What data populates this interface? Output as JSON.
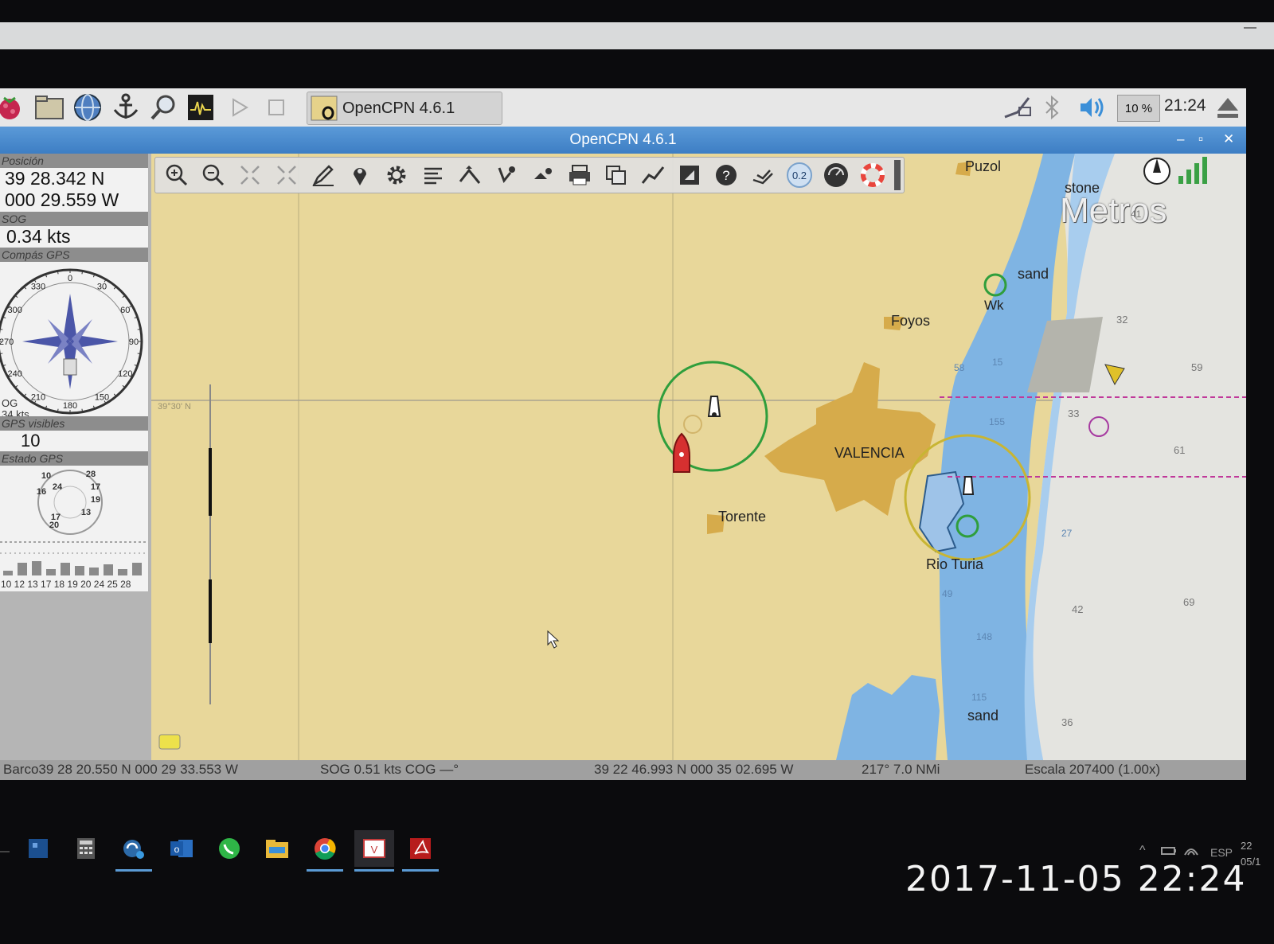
{
  "taskbar": {
    "app_title": "OpenCPN 4.6.1",
    "cpu_label": "10 %",
    "clock": "21:24",
    "launchers": [
      "raspberry-icon",
      "file-manager-icon",
      "web-browser-icon",
      "anchor-icon",
      "search-icon",
      "terminal-icon",
      "play-icon",
      "stop-icon"
    ]
  },
  "window": {
    "title": "OpenCPN 4.6.1",
    "minimize": "–",
    "maximize": "▫",
    "close": "✕"
  },
  "dashboard": {
    "position_title": "Posición",
    "lat": "39 28.342 N",
    "lon": "000 29.559 W",
    "sog_title": "SOG",
    "sog": "0.34 kts",
    "compass_title": "Compás GPS",
    "compass_ticks": [
      "0",
      "30",
      "60",
      "90",
      "120",
      "150",
      "180",
      "210",
      "240",
      "270",
      "300",
      "330"
    ],
    "compass_readout": [
      "OG",
      "34 kts"
    ],
    "gps_visible_title": "GPS visibles",
    "gps_visible": "10",
    "gps_status_title": "Estado GPS",
    "sat_ids": [
      "10",
      "28",
      "16",
      "24",
      "17",
      "19",
      "17",
      "13",
      "20"
    ],
    "signal_ids": "10 12 13 17 18 19 20 24 25 28",
    "signal_levels": [
      0.15,
      0.4,
      0.45,
      0.2,
      0.4,
      0.3,
      0.25,
      0.35,
      0.2,
      0.4
    ]
  },
  "toolbar": {
    "tools": [
      "zoom-in-icon",
      "zoom-out-icon",
      "shrink-icon",
      "expand-icon",
      "pencil-icon",
      "pin-icon",
      "settings-icon",
      "text-icon",
      "route-icon",
      "track-icon",
      "boat-icon",
      "print-icon",
      "layers-icon",
      "graph-icon",
      "export-icon",
      "help-icon",
      "ais-icon",
      "scale-icon",
      "compass-dial-icon",
      "lifebuoy-icon"
    ],
    "scale_button_label": "0.2"
  },
  "chart": {
    "lat_grid_label": "39°30' N",
    "metros_label": "Metros",
    "places": {
      "puzol": "Puzol",
      "foyos": "Foyos",
      "valencia": "VALENCIA",
      "torente": "Torente",
      "rio_turia": "Rio Turia"
    },
    "seabed": {
      "stone": "stone",
      "sand_top": "sand",
      "sand_bottom": "sand",
      "wk": "Wk"
    },
    "depths": [
      "41",
      "32",
      "59",
      "33",
      "61",
      "42",
      "69",
      "36",
      "27",
      "15",
      "58",
      "155",
      "49",
      "148",
      "115"
    ],
    "colors": {
      "land": "#e8d79a",
      "town": "#d6ab4b",
      "shallow": "#7fb4e3",
      "deep": "#e4e4e0",
      "route": "#c0399a",
      "range_green": "#2f9e3c",
      "range_yellow": "#c8b533",
      "ship": "#d63030"
    }
  },
  "status": {
    "boat": "Barco39 28 20.550 N  000 29 33.553 W",
    "sog_cog": "SOG 0.51 kts  COG —°",
    "cursor": "39 22 46.993 N   000 35 02.695 W",
    "bearing": "217°  7.0 NMi",
    "scale": "Escala 207400 (1.00x)"
  },
  "win_taskbar": {
    "apps": [
      "start-tile-icon",
      "calculator-icon",
      "sync-icon",
      "outlook-icon",
      "whatsapp-icon",
      "explorer-icon",
      "chrome-icon",
      "visio-icon",
      "acrobat-icon"
    ],
    "lang": "ESP",
    "date_short": "05/1",
    "hour_short": "22"
  },
  "photo_timestamp": "2017-11-05  22:24"
}
